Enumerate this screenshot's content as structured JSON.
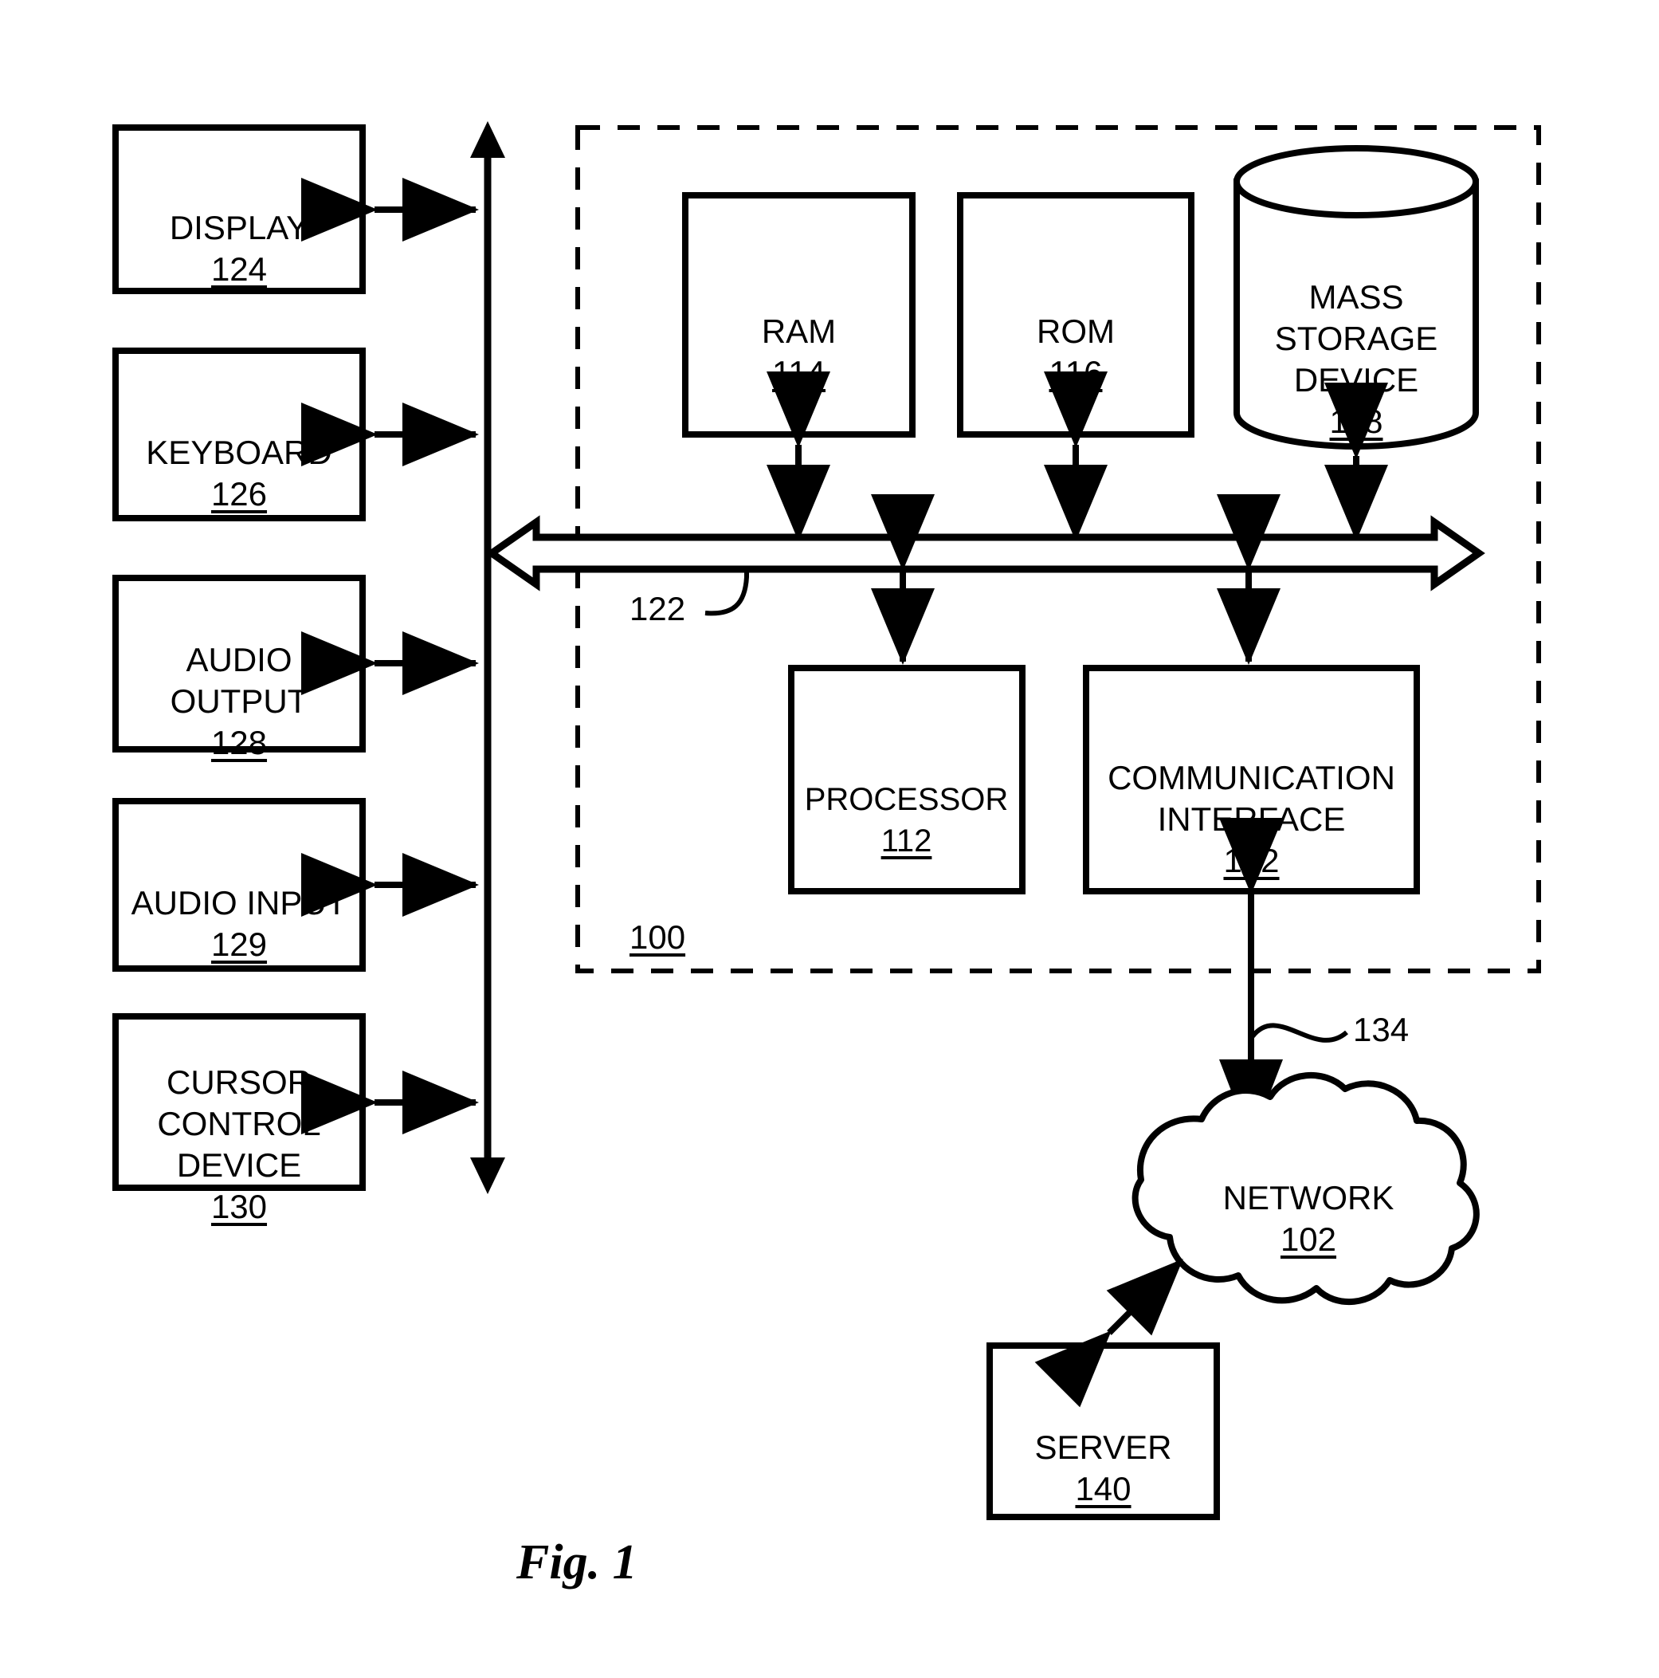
{
  "figure": {
    "caption": "Fig. 1",
    "system_ref": "100"
  },
  "peripherals": [
    {
      "name": "DISPLAY",
      "ref": "124"
    },
    {
      "name": "KEYBOARD",
      "ref": "126"
    },
    {
      "name": "AUDIO\nOUTPUT",
      "ref": "128"
    },
    {
      "name": "AUDIO INPUT",
      "ref": "129"
    },
    {
      "name": "CURSOR\nCONTROL\nDEVICE",
      "ref": "130"
    }
  ],
  "internal_components": [
    {
      "name": "RAM",
      "ref": "114"
    },
    {
      "name": "ROM",
      "ref": "116"
    },
    {
      "name": "MASS\nSTORAGE\nDEVICE",
      "ref": "118"
    },
    {
      "name": "PROCESSOR",
      "ref": "112"
    },
    {
      "name": "COMMUNICATION\nINTERFACE",
      "ref": "132"
    }
  ],
  "bus": {
    "ref": "122"
  },
  "external": [
    {
      "name": "NETWORK",
      "ref": "102"
    },
    {
      "name": "SERVER",
      "ref": "140"
    }
  ],
  "connection": {
    "ref": "134"
  }
}
